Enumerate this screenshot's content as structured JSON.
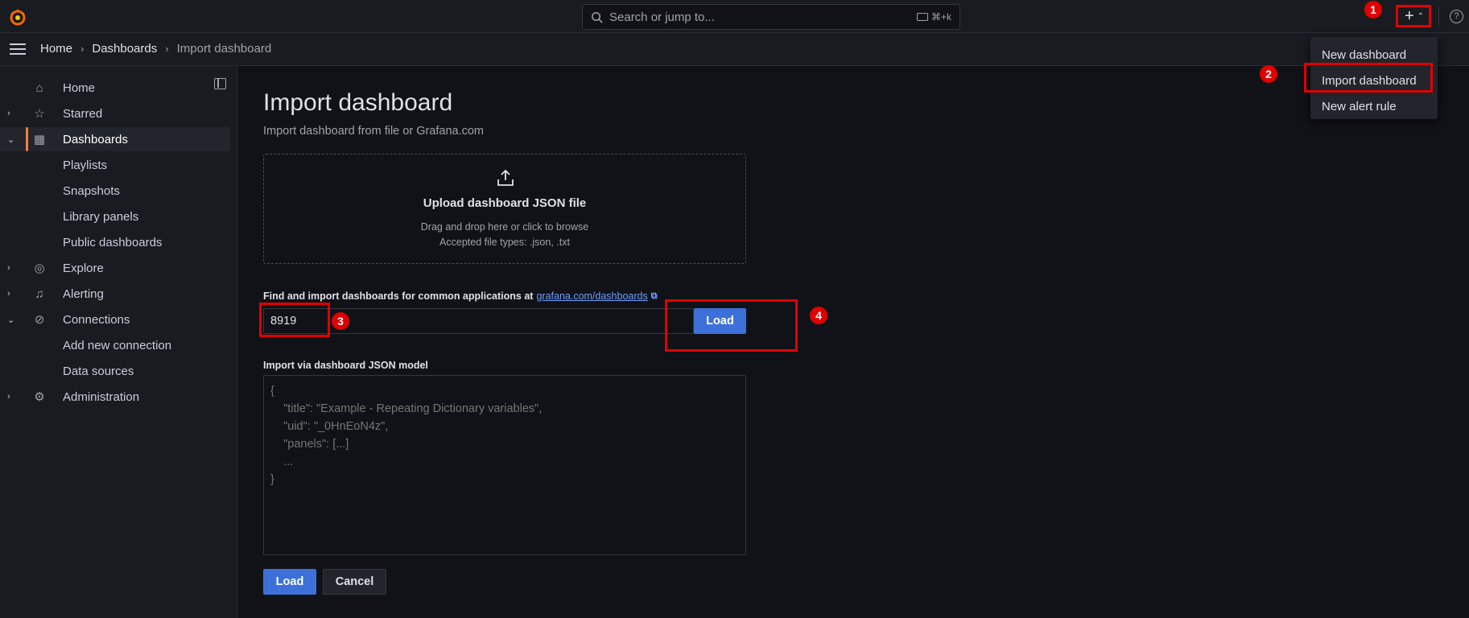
{
  "topbar": {
    "search_placeholder": "Search or jump to...",
    "search_shortcut": "⌘+k",
    "plus_label": "+",
    "help_glyph": "?"
  },
  "breadcrumb": [
    "Home",
    "Dashboards",
    "Import dashboard"
  ],
  "sidebar": {
    "items": [
      {
        "label": "Home",
        "icon": "home-icon",
        "glyph": "⌂",
        "expandable": false
      },
      {
        "label": "Starred",
        "icon": "star-icon",
        "glyph": "☆",
        "expandable": true
      },
      {
        "label": "Dashboards",
        "icon": "dashboards-grid-icon",
        "glyph": "▦",
        "expandable": true,
        "expanded": true,
        "active": true
      },
      {
        "label": "Playlists",
        "sub": true
      },
      {
        "label": "Snapshots",
        "sub": true
      },
      {
        "label": "Library panels",
        "sub": true
      },
      {
        "label": "Public dashboards",
        "sub": true
      },
      {
        "label": "Explore",
        "icon": "compass-icon",
        "glyph": "◎",
        "expandable": true
      },
      {
        "label": "Alerting",
        "icon": "bell-icon",
        "glyph": "♫",
        "expandable": true
      },
      {
        "label": "Connections",
        "icon": "connections-icon",
        "glyph": "⊘",
        "expandable": true,
        "expanded": true
      },
      {
        "label": "Add new connection",
        "sub": true
      },
      {
        "label": "Data sources",
        "sub": true
      },
      {
        "label": "Administration",
        "icon": "gear-icon",
        "glyph": "⚙",
        "expandable": true
      }
    ]
  },
  "menu": {
    "items": [
      "New dashboard",
      "Import dashboard",
      "New alert rule"
    ]
  },
  "main": {
    "title": "Import dashboard",
    "subtitle": "Import dashboard from file or Grafana.com",
    "upload_title": "Upload dashboard JSON file",
    "upload_hint1": "Drag and drop here or click to browse",
    "upload_hint2": "Accepted file types: .json, .txt",
    "gcom_label": "Find and import dashboards for common applications at",
    "gcom_link": "grafana.com/dashboards",
    "dashboard_id_value": "8919",
    "load_label": "Load",
    "json_label": "Import via dashboard JSON model",
    "json_placeholder": "{\n    \"title\": \"Example - Repeating Dictionary variables\",\n    \"uid\": \"_0HnEoN4z\",\n    \"panels\": [...]\n    ...\n}",
    "cancel_label": "Cancel"
  },
  "annotations": [
    "1",
    "2",
    "3",
    "4"
  ],
  "colors": {
    "accent": "#ff7a3c",
    "primary_button": "#3d71d9",
    "annotation_red": "#e00000",
    "link": "#6e9fff"
  }
}
